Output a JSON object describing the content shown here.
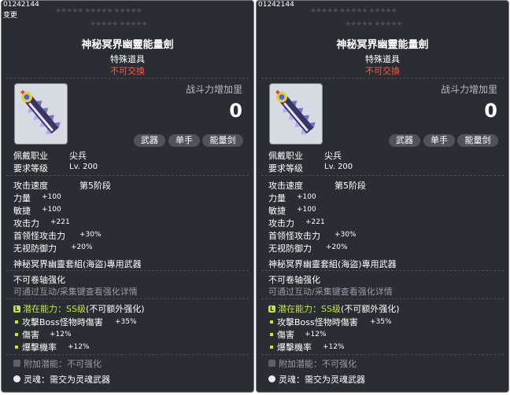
{
  "tooltip": {
    "item_id": "01242144",
    "changed": "变更",
    "stars_row1": "★★★★★ ★★★★★ ★★★★★",
    "stars_row2": "★★★★★ ★★★★★",
    "title": "神秘冥界幽靈能量劍",
    "subtitle": "特殊道具",
    "untradeable": "不可交換",
    "power_label": "战斗力增加里",
    "power_value": "0",
    "tags": [
      "武器",
      "单手",
      "能量剑"
    ],
    "job_label": "佩戴职业",
    "job_value": "尖兵",
    "level_label": "要求等级",
    "level_value": "Lv. 200",
    "speed_label": "攻击速度",
    "speed_value": "第5阶段",
    "stats": [
      {
        "label": "力量",
        "value": "+100"
      },
      {
        "label": "敏捷",
        "value": "+100"
      },
      {
        "label": "攻击力",
        "value": "+221"
      },
      {
        "label": "首领怪攻击力",
        "value": "+30%"
      },
      {
        "label": "无视防御力",
        "value": "+20%"
      }
    ],
    "exclusive": "神秘冥界幽靈套組(海盜)專用武器",
    "no_scroll": "不可卷轴强化",
    "enhance_hint": "可通过互动/采集键查看强化详情",
    "potential_label": "潜在能力",
    "potential_grade": "：SS级",
    "potential_note": "(不可额外强化)",
    "potentials": [
      {
        "label": "攻擊Boss怪物時傷害",
        "value": "+35%"
      },
      {
        "label": "傷害",
        "value": "+12%"
      },
      {
        "label": "爆擊機率",
        "value": "+12%"
      }
    ],
    "additional_label": "附加潜能",
    "additional_value": "：不可强化",
    "soul_label": "灵魂",
    "soul_value": "：需交为灵魂武器",
    "colors": {
      "background": "#2a2d33",
      "untradeable": "#ff5a3a",
      "potential": "#c9e83a",
      "muted": "#9a9da3"
    }
  }
}
